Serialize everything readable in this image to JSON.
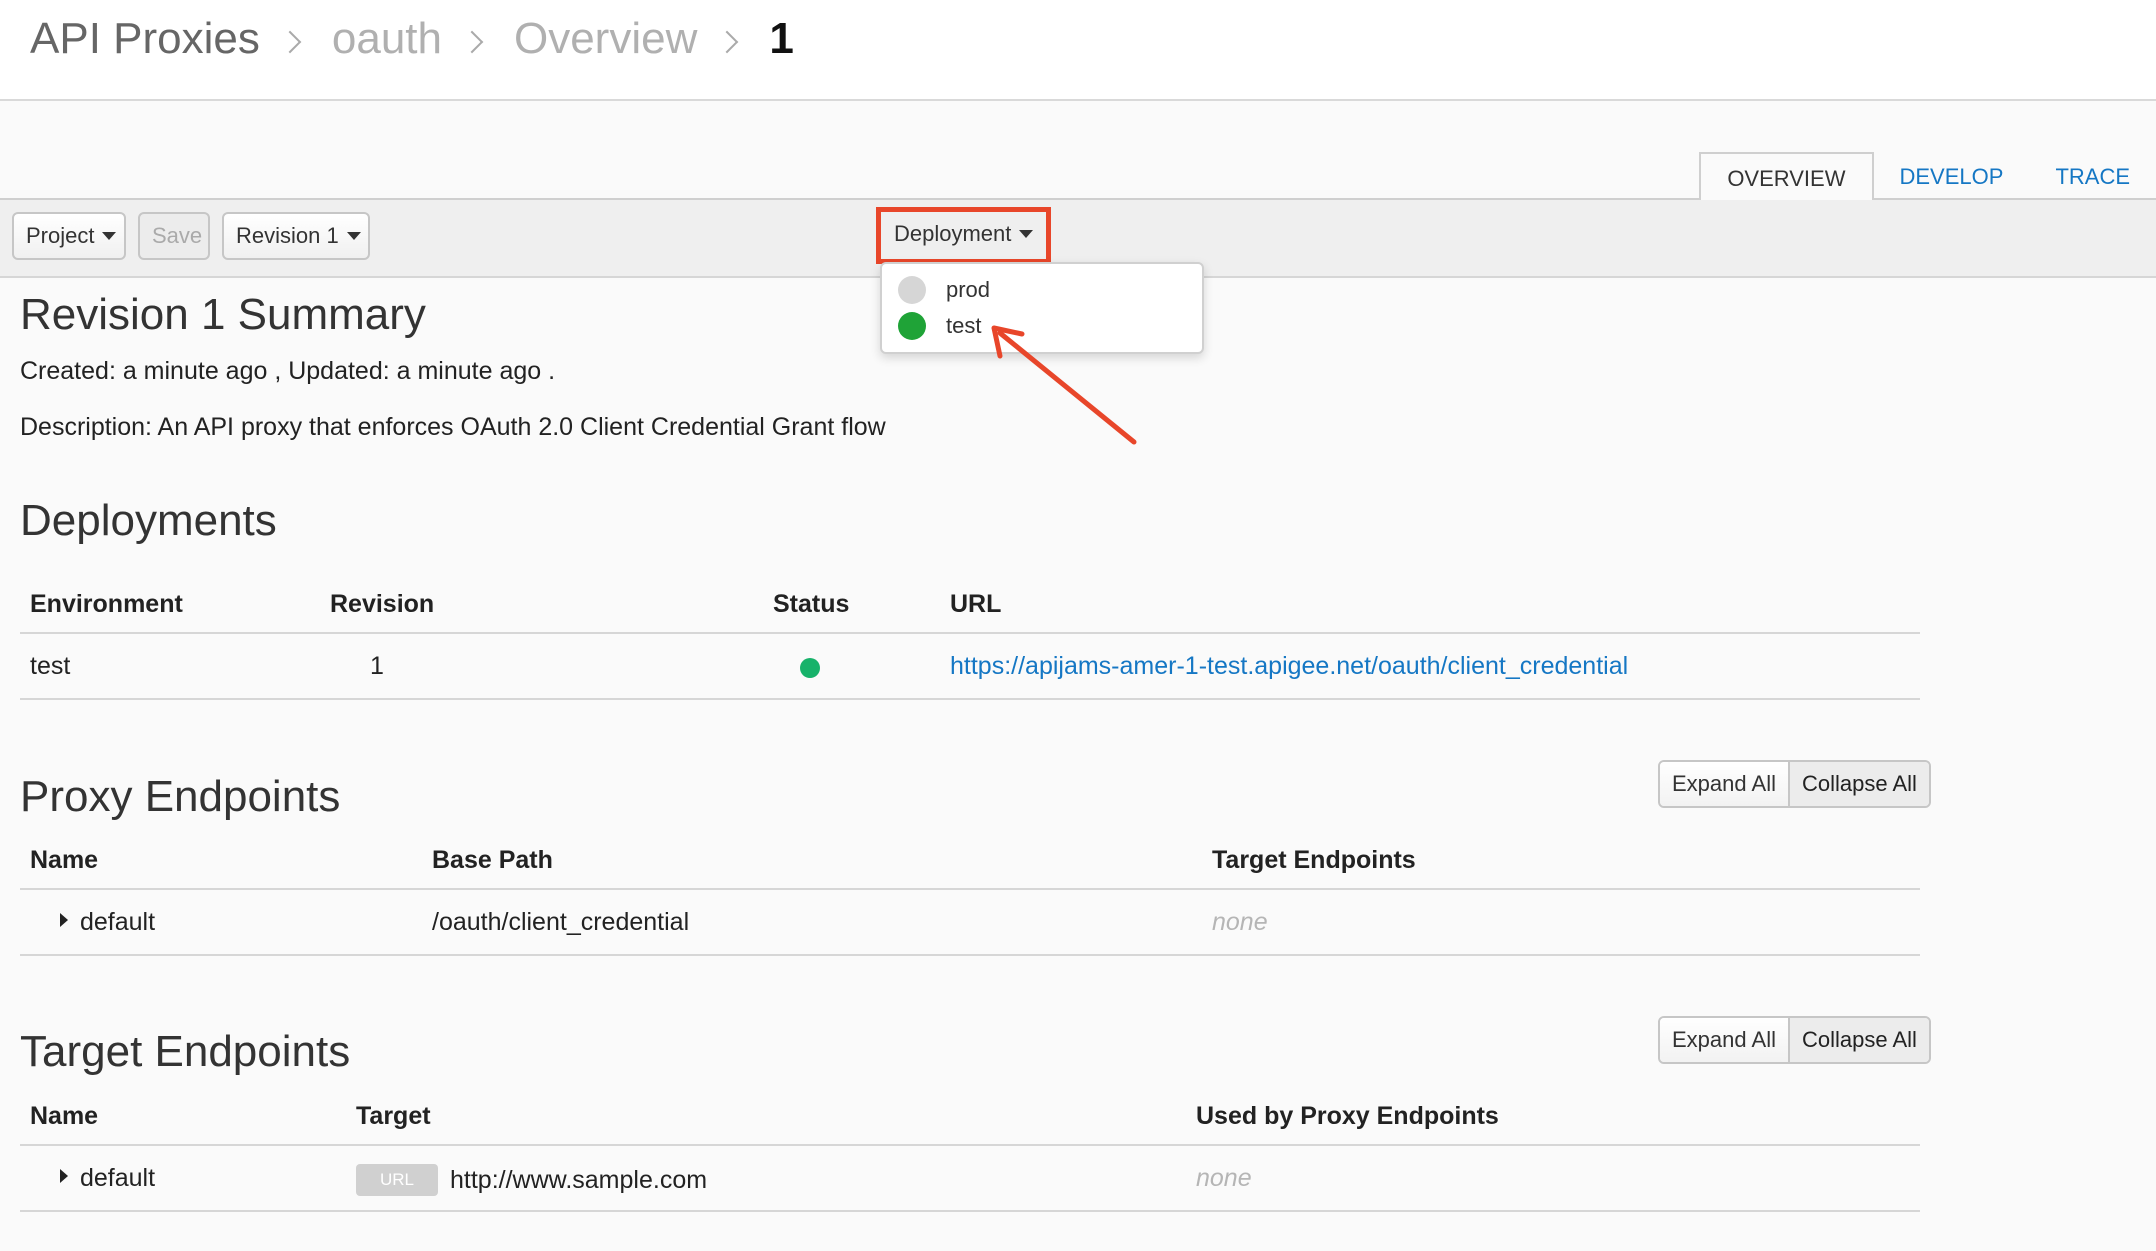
{
  "breadcrumb": {
    "items": [
      "API Proxies",
      "oauth",
      "Overview",
      "1"
    ]
  },
  "tabs": {
    "overview": "OVERVIEW",
    "develop": "DEVELOP",
    "trace": "TRACE"
  },
  "toolbar": {
    "project": "Project",
    "save": "Save",
    "revision": "Revision 1",
    "deployment": "Deployment"
  },
  "deployment_menu": {
    "items": [
      {
        "label": "prod",
        "status_color": "#d6d6d6"
      },
      {
        "label": "test",
        "status_color": "#1fa337"
      }
    ]
  },
  "summary": {
    "title": "Revision 1 Summary",
    "created_line": "Created: a minute ago , Updated: a minute ago .",
    "description_line": "Description: An API proxy that enforces OAuth 2.0 Client Credential Grant flow"
  },
  "deployments": {
    "title": "Deployments",
    "columns": [
      "Environment",
      "Revision",
      "Status",
      "URL"
    ],
    "rows": [
      {
        "environment": "test",
        "revision": "1",
        "status_color": "#17b26a",
        "url": "https://apijams-amer-1-test.apigee.net/oauth/client_credential"
      }
    ]
  },
  "proxy_endpoints": {
    "title": "Proxy Endpoints",
    "expand_all": "Expand All",
    "collapse_all": "Collapse All",
    "columns": [
      "Name",
      "Base Path",
      "Target Endpoints"
    ],
    "rows": [
      {
        "name": "default",
        "base_path": "/oauth/client_credential",
        "target_endpoints": "none"
      }
    ]
  },
  "target_endpoints": {
    "title": "Target Endpoints",
    "expand_all": "Expand All",
    "collapse_all": "Collapse All",
    "columns": [
      "Name",
      "Target",
      "Used by Proxy Endpoints"
    ],
    "rows": [
      {
        "name": "default",
        "target_badge": "URL",
        "target": "http://www.sample.com",
        "used_by": "none"
      }
    ]
  },
  "colors": {
    "accent_link": "#1577c4",
    "highlight_box": "#e8462a"
  },
  "icons": [
    "chevron-right-icon",
    "caret-down-icon",
    "caret-right-icon",
    "status-dot-icon",
    "annotation-arrow-icon"
  ]
}
